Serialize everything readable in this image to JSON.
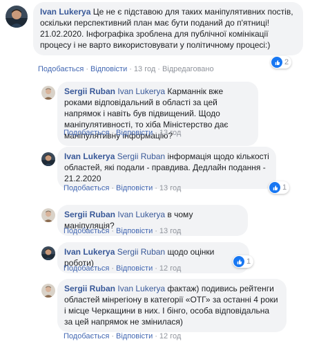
{
  "comments": [
    {
      "author": "Ivan Lukerya",
      "mention": "",
      "text": "Це не є підставою для таких маніпулятивних постів, оскільки перспективний план має бути поданий до п'ятниці! 21.02.2020. Інфографіка зроблена для публічної комінікації процесу і не варто використовувати у політичному процесі:)",
      "like_label": "Подобається",
      "reply_label": "Відповісти",
      "time": "13 год",
      "edited": "Відредаговано",
      "reactions": "2"
    },
    {
      "author": "Sergii Ruban",
      "mention": "Ivan Lukerya",
      "text": "Карманнік вже роками відповідальний в області за цей напрямок і навіть був підвищений. Щодо маніпулятивності, то хіба Міністерство дає маніпулятивну інформацію?",
      "like_label": "Подобається",
      "reply_label": "Відповісти",
      "time": "13 год"
    },
    {
      "author": "Ivan Lukerya",
      "mention": "Sergii Ruban",
      "text": "інформація щодо кількості областей, які подали - правдива. Дедлайн подання - 21.2.2020",
      "like_label": "Подобається",
      "reply_label": "Відповісти",
      "time": "13 год",
      "reactions": "1"
    },
    {
      "author": "Sergii Ruban",
      "mention": "Ivan Lukerya",
      "text": "в чому маніпуляція?",
      "like_label": "Подобається",
      "reply_label": "Відповісти",
      "time": "13 год"
    },
    {
      "author": "Ivan Lukerya",
      "mention": "Sergii Ruban",
      "text": "щодо оцінки роботи)",
      "like_label": "Подобається",
      "reply_label": "Відповісти",
      "time": "12 год",
      "reactions": "1"
    },
    {
      "author": "Sergii Ruban",
      "mention": "Ivan Lukerya",
      "text": "фактаж) подивись рейтенги областей мінрегіону в категорії «ОТГ» за останні 4 роки і місце Черкащини в них. І бінго, особа відповідальна за цей напрямок не змінилася)",
      "like_label": "Подобається",
      "reply_label": "Відповісти",
      "time": "12 год"
    }
  ],
  "colors": {
    "link": "#385898",
    "action": "#4267b2",
    "meta": "#90949c",
    "bubble": "#f2f3f5",
    "like": "#1877f2"
  }
}
